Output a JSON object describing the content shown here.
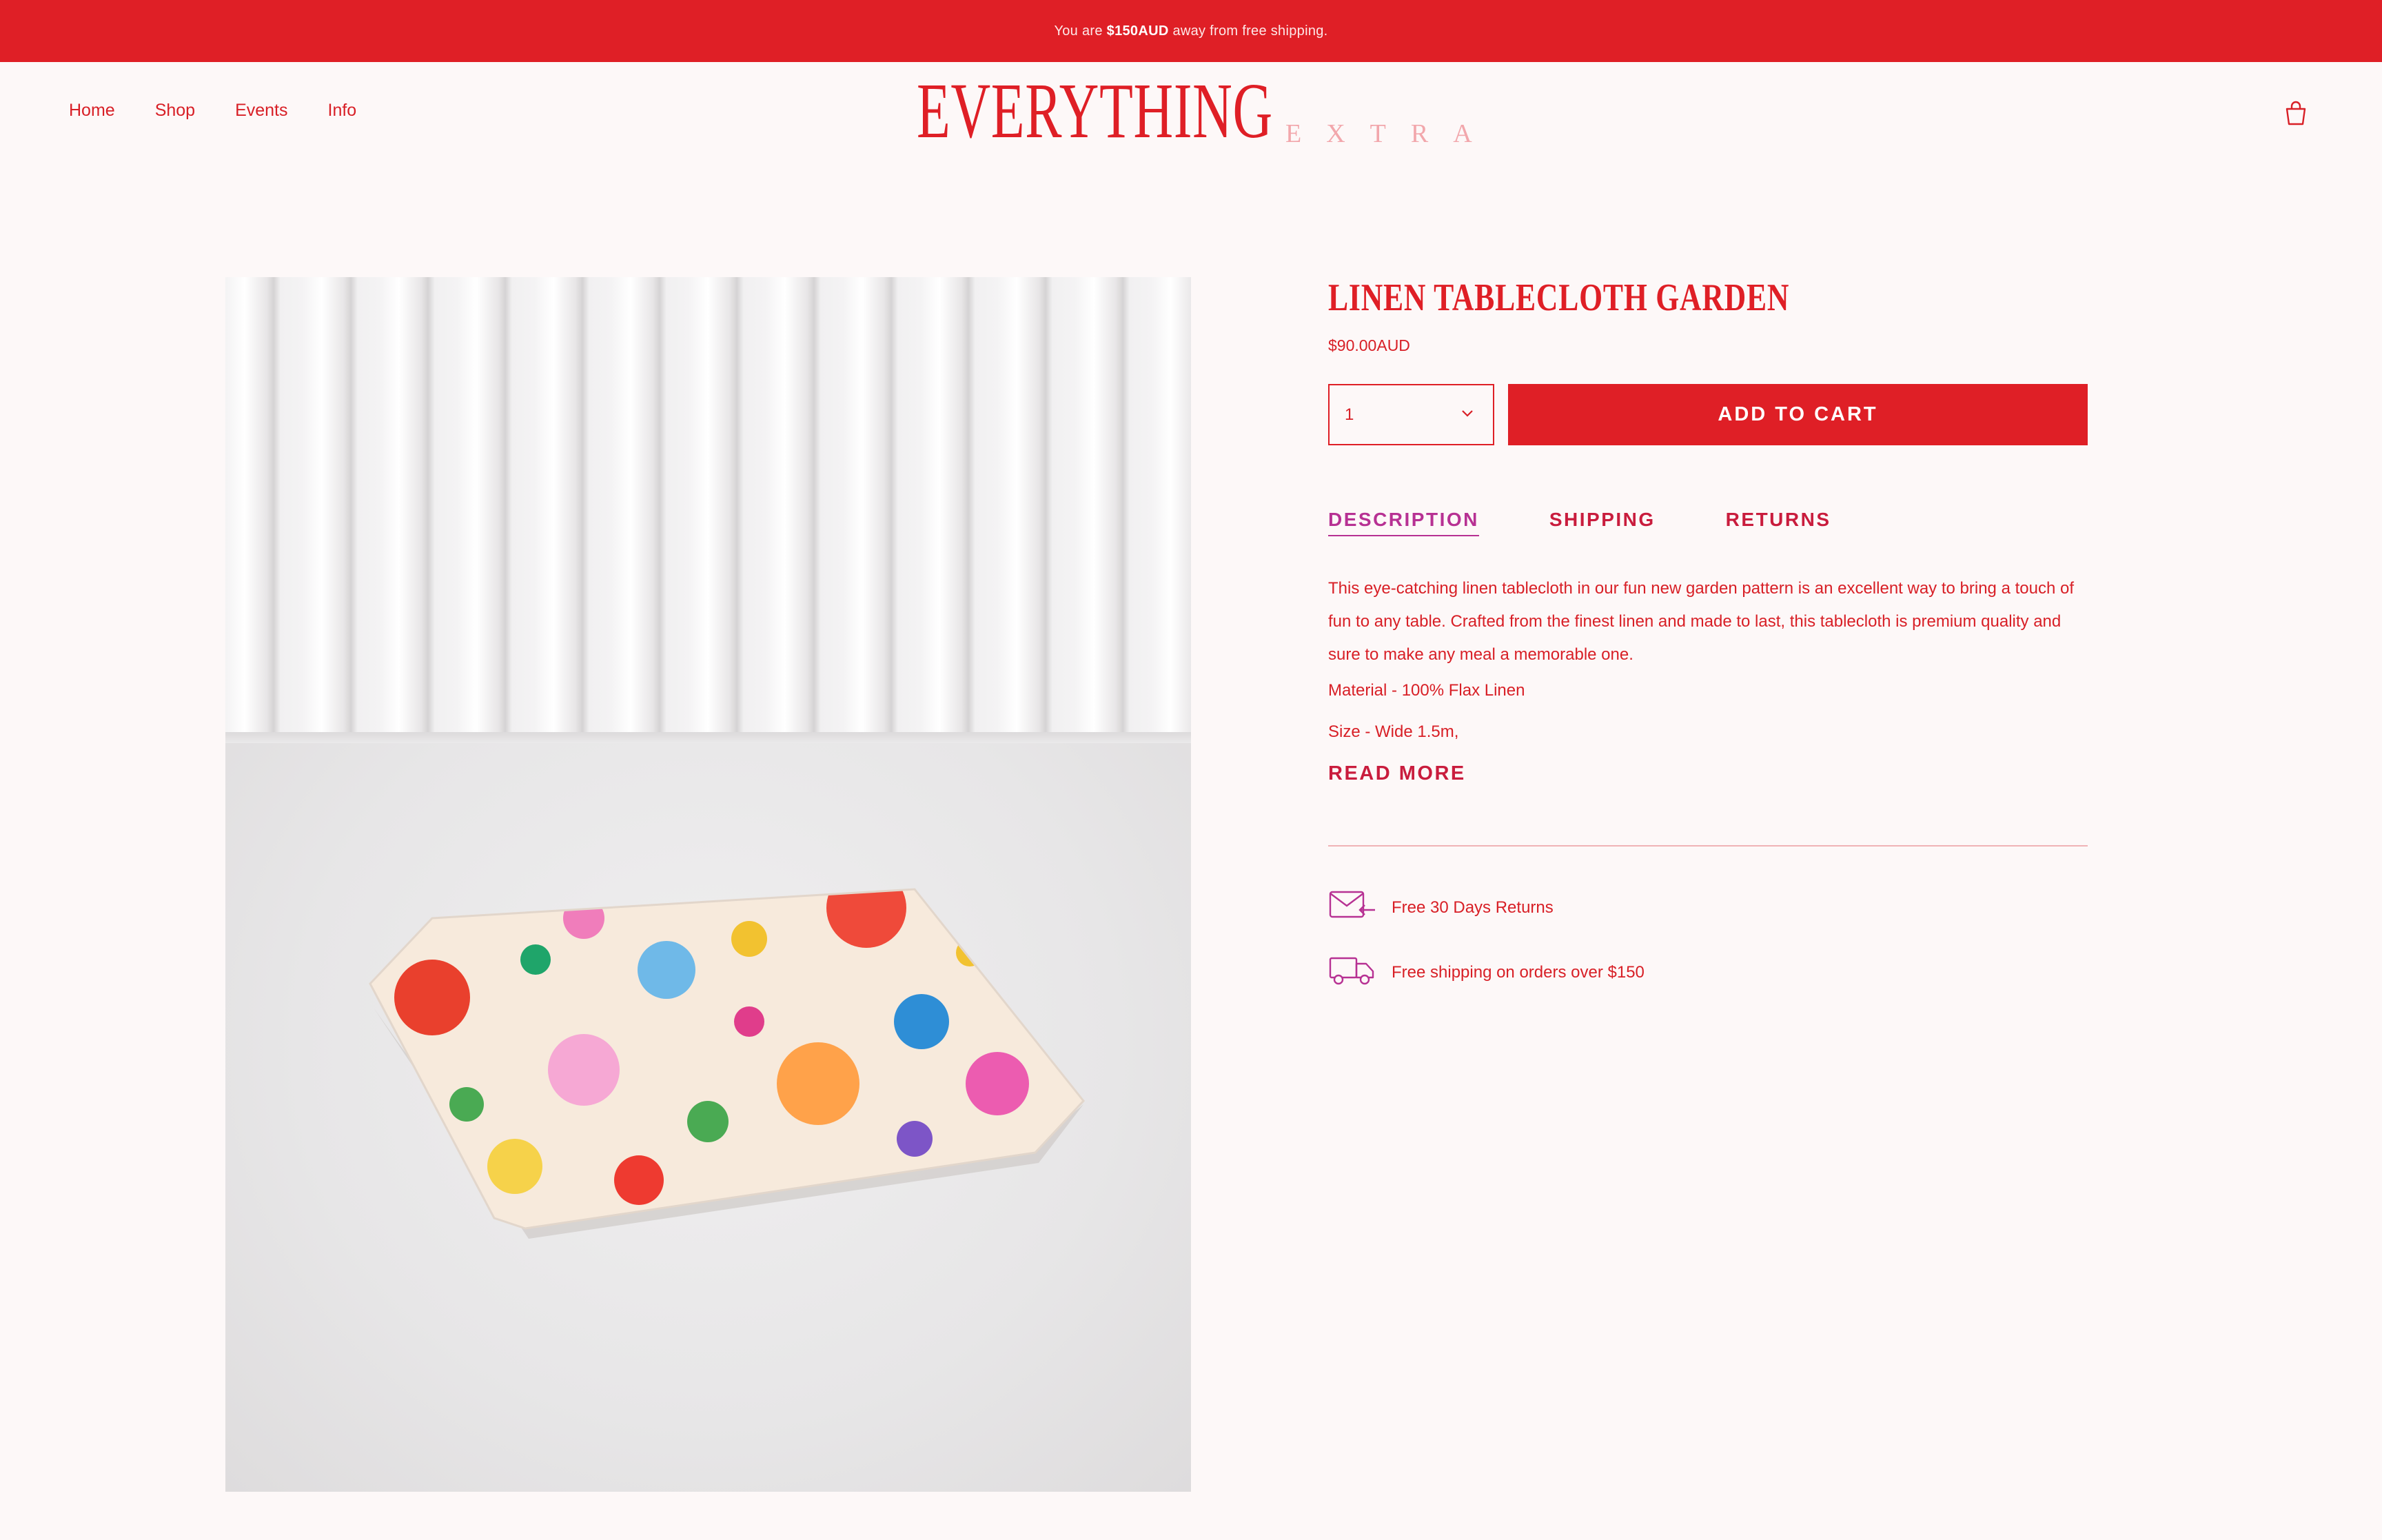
{
  "announcement": {
    "prefix": "You are",
    "amount": "$150AUD",
    "suffix": "away from free shipping."
  },
  "nav": {
    "items": [
      {
        "label": "Home"
      },
      {
        "label": "Shop"
      },
      {
        "label": "Events"
      },
      {
        "label": "Info"
      }
    ]
  },
  "logo": {
    "main": "EVERYTHING",
    "sub": "EXTRA"
  },
  "header": {
    "cart_icon": "shopping-bag-icon"
  },
  "product": {
    "title": "LINEN TABLECLOTH GARDEN",
    "price": "$90.00AUD",
    "quantity": "1",
    "add_to_cart_label": "ADD TO CART",
    "tabs": [
      {
        "label": "DESCRIPTION",
        "active": true
      },
      {
        "label": "SHIPPING",
        "active": false
      },
      {
        "label": "RETURNS",
        "active": false
      }
    ],
    "description": "This eye-catching linen tablecloth in our fun new garden pattern is an excellent way to bring a touch of fun to any table. Crafted from the finest linen and made to last, this tablecloth is premium quality and sure to make any meal a memorable one.",
    "material": "Material - 100% Flax Linen",
    "size": "Size - Wide 1.5m,",
    "read_more_label": "READ MORE",
    "perks": [
      {
        "icon": "returns-envelope-icon",
        "text": "Free 30 Days Returns"
      },
      {
        "icon": "delivery-truck-icon",
        "text": "Free shipping on orders over $150"
      }
    ]
  },
  "colors": {
    "brand_red": "#df1f26",
    "accent_magenta": "#b73193",
    "background": "#fdf8f8",
    "logo_sub_pink": "#f2a7ac"
  }
}
